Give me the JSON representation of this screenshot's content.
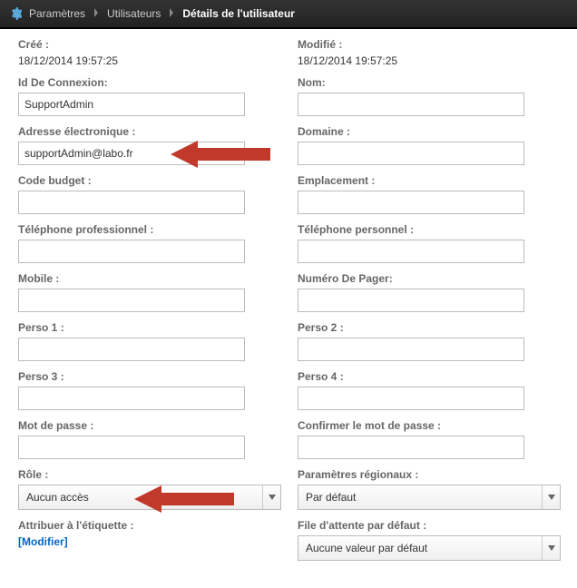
{
  "breadcrumb": {
    "settings": "Paramètres",
    "users": "Utilisateurs",
    "details": "Détails de l'utilisateur"
  },
  "left": {
    "created_label": "Créé :",
    "created_value": "18/12/2014 19:57:25",
    "login_id_label": "Id De Connexion:",
    "login_id_value": "SupportAdmin",
    "email_label": "Adresse électronique :",
    "email_value": "supportAdmin@labo.fr",
    "budget_label": "Code budget :",
    "budget_value": "",
    "work_phone_label": "Téléphone professionnel :",
    "work_phone_value": "",
    "mobile_label": "Mobile :",
    "mobile_value": "",
    "perso1_label": "Perso 1 :",
    "perso1_value": "",
    "perso3_label": "Perso 3 :",
    "perso3_value": "",
    "password_label": "Mot de passe :",
    "password_value": "",
    "role_label": "Rôle :",
    "role_value": "Aucun accès",
    "tag_label": "Attribuer à l'étiquette :",
    "tag_link": "[Modifier]"
  },
  "right": {
    "modified_label": "Modifié :",
    "modified_value": "18/12/2014 19:57:25",
    "name_label": "Nom:",
    "name_value": "",
    "domain_label": "Domaine :",
    "domain_value": "",
    "location_label": "Emplacement :",
    "location_value": "",
    "personal_phone_label": "Téléphone personnel :",
    "personal_phone_value": "",
    "pager_label": "Numéro De Pager:",
    "pager_value": "",
    "perso2_label": "Perso 2 :",
    "perso2_value": "",
    "perso4_label": "Perso 4 :",
    "perso4_value": "",
    "confirm_pw_label": "Confirmer le mot de passe  :",
    "confirm_pw_value": "",
    "regional_label": "Paramètres régionaux :",
    "regional_value": "Par défaut",
    "queue_label": "File d'attente par défaut :",
    "queue_value": "Aucune valeur par défaut"
  }
}
